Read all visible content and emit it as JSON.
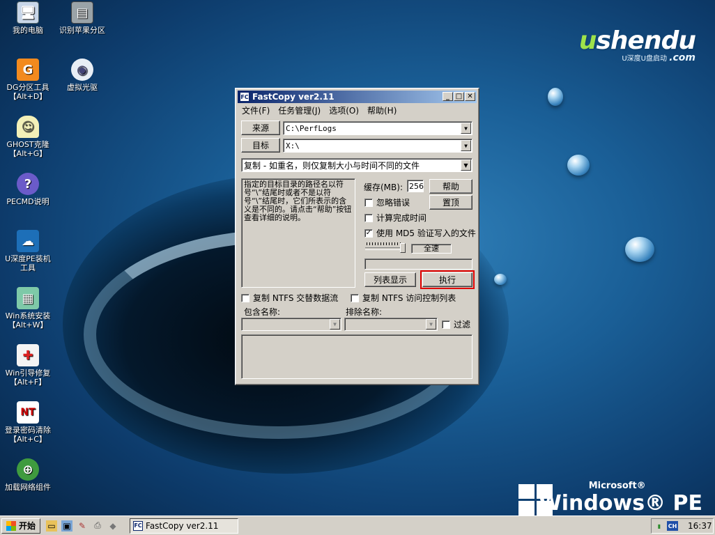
{
  "desktop": {
    "brand_name_a": "u",
    "brand_name_b": "shendu",
    "brand_domain": ".com",
    "brand_tagline": "U深度U盘启动",
    "winpe_vendor": "Microsoft®",
    "winpe_name": "Windows® PE",
    "icons": [
      {
        "label": "我的电脑"
      },
      {
        "label": "识别苹果分区"
      },
      {
        "label": "DG分区工具\n【Alt+D】"
      },
      {
        "label": "虚拟光驱"
      },
      {
        "label": "GHOST克隆\n【Alt+G】"
      },
      {
        "label": "PECMD说明"
      },
      {
        "label": "U深度PE装机\n工具"
      },
      {
        "label": "Win系统安装\n【Alt+W】"
      },
      {
        "label": "Win引导修复\n【Alt+F】"
      },
      {
        "label": "登录密码清除\n【Alt+C】"
      },
      {
        "label": "加载网络组件"
      }
    ]
  },
  "window": {
    "title": "FastCopy ver2.11",
    "app_icon_text": "FC",
    "menus": [
      "文件(F)",
      "任务管理(J)",
      "选项(O)",
      "帮助(H)"
    ],
    "source_button": "来源",
    "source_value": "C:\\PerfLogs",
    "dest_button": "目标",
    "dest_value": "X:\\",
    "mode_value": "复制 - 如重名，则仅复制大小与时间不同的文件",
    "description": "指定的目标目录的路径名以符号“\\”结尾时或者不是以符号“\\”结尾时，它们所表示的含义是不同的。请点击“帮助”按钮查看详细的说明。",
    "buffer_label": "缓存(MB):",
    "buffer_value": "256",
    "help_button": "帮助",
    "top_button": "置顶",
    "ignore_errors": {
      "label": "忽略错误",
      "checked": false
    },
    "calc_time": {
      "label": "计算完成时间",
      "checked": false
    },
    "md5_verify": {
      "label": "使用 MD5 验证写入的文件",
      "checked": true
    },
    "speed_label": "全速",
    "list_button": "列表显示",
    "execute_button": "执行",
    "copy_ntfs_streams": {
      "label": "复制 NTFS 交替数据流",
      "checked": false
    },
    "copy_ntfs_acl": {
      "label": "复制 NTFS 访问控制列表",
      "checked": false
    },
    "include_label": "包含名称:",
    "exclude_label": "排除名称:",
    "filter": {
      "label": "过滤",
      "checked": false
    }
  },
  "taskbar": {
    "start_label": "开始",
    "task_label": "FastCopy ver2.11",
    "ime_label": "CH",
    "clock": "16:37"
  }
}
